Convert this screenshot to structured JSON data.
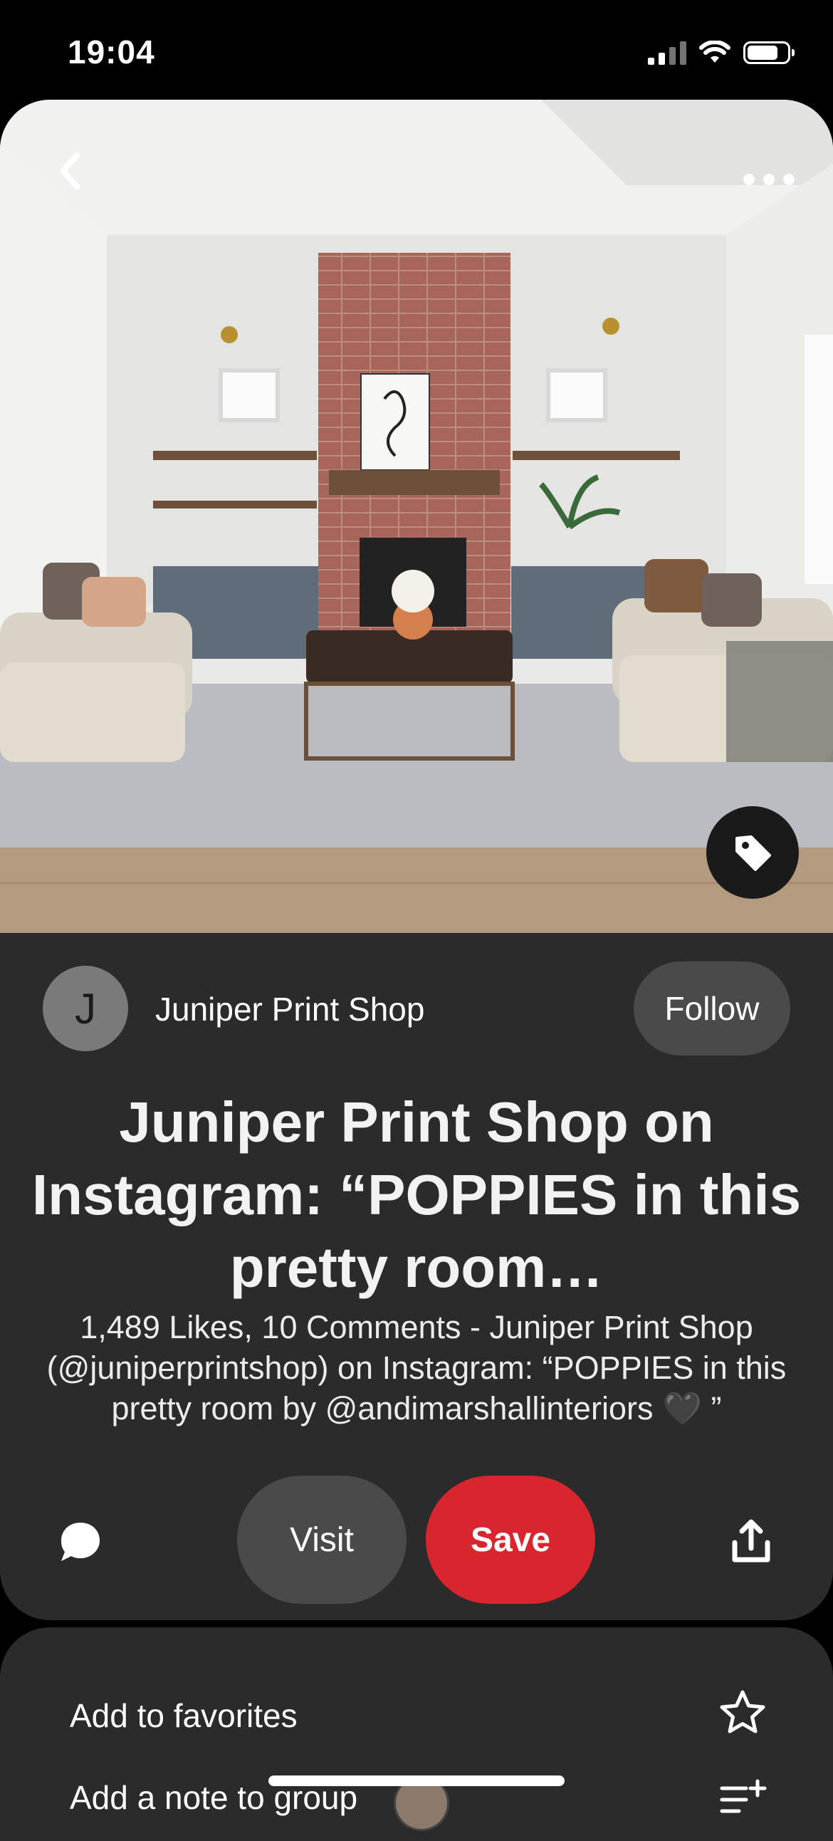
{
  "status_bar": {
    "time": "19:04",
    "icons": [
      "signal-icon",
      "wifi-icon",
      "battery-icon"
    ]
  },
  "pin": {
    "image_icons": [
      "back-icon",
      "more-icon",
      "tag-icon"
    ],
    "creator": {
      "avatar_initial": "J",
      "name": "Juniper Print Shop",
      "follow_label": "Follow"
    },
    "title": "Juniper Print Shop on Instagram: “POPPIES in this pretty room…",
    "description": "1,489 Likes, 10 Comments - Juniper Print Shop (@juniperprintshop) on Instagram: “POPPIES in this pretty room by @andimarshallinteriors 🖤 ”",
    "actions": {
      "visit_label": "Visit",
      "save_label": "Save",
      "icons": [
        "comment-icon",
        "share-icon"
      ]
    }
  },
  "bottom_sheet": {
    "favorites_label": "Add to favorites",
    "note_label": "Add a note to group",
    "icons": [
      "star-icon",
      "list-add-icon"
    ]
  },
  "colors": {
    "background": "#000000",
    "card": "#2b2b2b",
    "button_gray": "#4a4a4a",
    "save_red": "#d7262d"
  }
}
